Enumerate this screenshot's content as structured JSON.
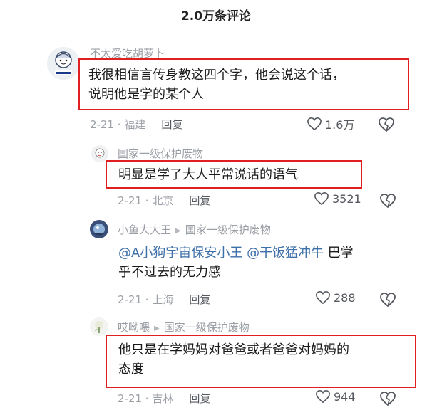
{
  "header": {
    "title": "2.0万条评论"
  },
  "comments": [
    {
      "user": "不太爱吃胡萝卜",
      "text_line1": "我很相信言传身教这四个字，他会说这个话，",
      "text_line2": "说明他是学的某个人",
      "meta": "2-21 · 福建",
      "reply_label": "回复",
      "likes": "1.6万"
    },
    {
      "user": "国家一级保护废物",
      "text_line1": "明显是学了大人平常说话的语气",
      "meta": "2-21 · 北京",
      "reply_label": "回复",
      "likes": "3521"
    },
    {
      "user": "小鱼大大王",
      "reply_to": "国家一级保护废物",
      "mention1": "@A小狗宇宙保安小王",
      "mention2": "@干饭猛冲牛",
      "text_tail": " 巴掌",
      "text_line2": "乎不过去的无力感",
      "meta": "2-21 · 上海",
      "reply_label": "回复",
      "likes": "288"
    },
    {
      "user": "哎呦喂",
      "reply_to": "国家一级保护废物",
      "text_line1": "他只是在学妈妈对爸爸或者爸爸对妈妈的",
      "text_line2": "态度",
      "meta": "2-21 · 吉林",
      "reply_label": "回复",
      "likes": "944"
    }
  ],
  "icons": {
    "heart": "heart-outline-icon",
    "dislike": "broken-heart-icon",
    "reply_arrow": "triangle-right-icon"
  },
  "colors": {
    "highlight_border": "#e02020",
    "mention": "#3d6fa8",
    "muted_text": "#9a9ea5"
  }
}
